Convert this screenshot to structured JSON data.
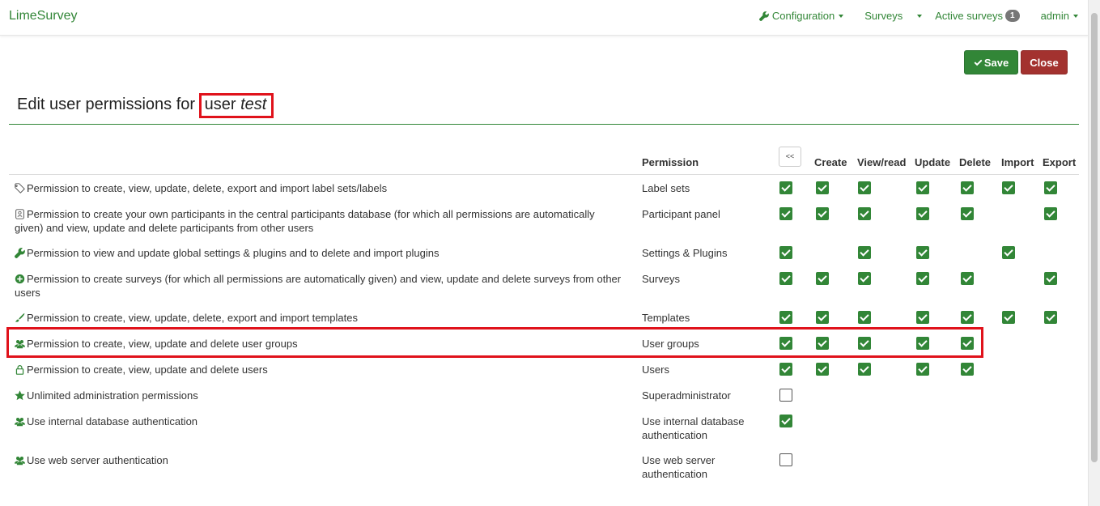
{
  "navbar": {
    "brand": "LimeSurvey",
    "configuration": "Configuration",
    "surveys": "Surveys",
    "active_surveys": "Active surveys",
    "active_count": "1",
    "user": "admin"
  },
  "toolbar": {
    "save_label": "Save",
    "close_label": "Close"
  },
  "page": {
    "title_prefix": "Edit user permissions for ",
    "title_user_word": "user",
    "title_username": "test"
  },
  "table": {
    "collapse_label": "<<",
    "headers": {
      "permission": "Permission",
      "create": "Create",
      "read": "View/read",
      "update": "Update",
      "delete": "Delete",
      "import": "Import",
      "export": "Export"
    },
    "rows": [
      {
        "icon": "tag-icon",
        "description": "Permission to create, view, update, delete, export and import label sets/labels",
        "permission": "Label sets",
        "values": {
          "all": true,
          "create": true,
          "read": true,
          "update": true,
          "delete": true,
          "import": true,
          "export": true
        }
      },
      {
        "icon": "participant-icon",
        "description": "Permission to create your own participants in the central participants database (for which all permissions are automatically given) and view, update and delete participants from other users",
        "permission": "Participant panel",
        "values": {
          "all": true,
          "create": true,
          "read": true,
          "update": true,
          "delete": true,
          "import": null,
          "export": true
        }
      },
      {
        "icon": "wrench-icon",
        "description": "Permission to view and update global settings & plugins and to delete and import plugins",
        "permission": "Settings & Plugins",
        "values": {
          "all": true,
          "create": null,
          "read": true,
          "update": true,
          "delete": null,
          "import": true,
          "export": null
        }
      },
      {
        "icon": "plus-circle-icon",
        "description": "Permission to create surveys (for which all permissions are automatically given) and view, update and delete surveys from other users",
        "permission": "Surveys",
        "values": {
          "all": true,
          "create": true,
          "read": true,
          "update": true,
          "delete": true,
          "import": null,
          "export": true
        }
      },
      {
        "icon": "brush-icon",
        "description": "Permission to create, view, update, delete, export and import templates",
        "permission": "Templates",
        "values": {
          "all": true,
          "create": true,
          "read": true,
          "update": true,
          "delete": true,
          "import": true,
          "export": true
        }
      },
      {
        "icon": "users-icon",
        "description": "Permission to create, view, update and delete user groups",
        "permission": "User groups",
        "values": {
          "all": true,
          "create": true,
          "read": true,
          "update": true,
          "delete": true,
          "import": null,
          "export": null
        }
      },
      {
        "icon": "lock-icon",
        "description": "Permission to create, view, update and delete users",
        "permission": "Users",
        "values": {
          "all": true,
          "create": true,
          "read": true,
          "update": true,
          "delete": true,
          "import": null,
          "export": null
        }
      },
      {
        "icon": "star-icon",
        "description": "Unlimited administration permissions",
        "permission": "Superadministrator",
        "values": {
          "all": false,
          "create": null,
          "read": null,
          "update": null,
          "delete": null,
          "import": null,
          "export": null
        }
      },
      {
        "icon": "users-icon",
        "description": "Use internal database authentication",
        "permission": "Use internal database authentication",
        "values": {
          "all": true,
          "create": null,
          "read": null,
          "update": null,
          "delete": null,
          "import": null,
          "export": null
        }
      },
      {
        "icon": "users-icon",
        "description": "Use web server authentication",
        "permission": "Use web server authentication",
        "values": {
          "all": false,
          "create": null,
          "read": null,
          "update": null,
          "delete": null,
          "import": null,
          "export": null
        }
      }
    ]
  },
  "colors": {
    "accent": "#328637",
    "danger": "#a3322f",
    "highlight": "#e0121b"
  }
}
